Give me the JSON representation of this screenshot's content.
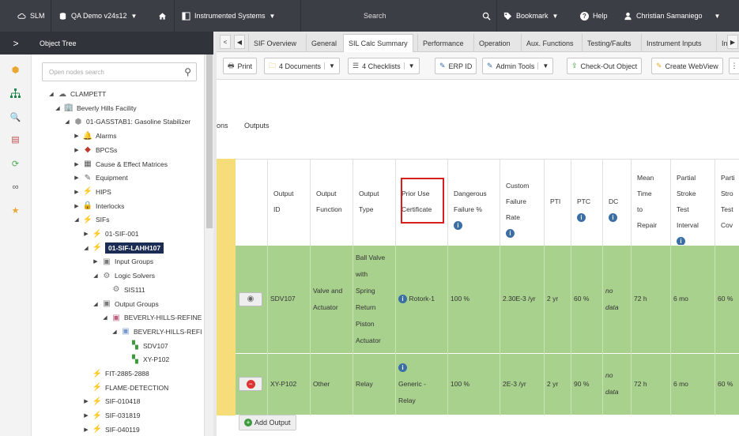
{
  "topbar": {
    "app": "SLM",
    "database": "QA Demo v24s12",
    "object_type": "Instrumented Systems",
    "search_placeholder": "Search",
    "bookmark": "Bookmark",
    "help": "Help",
    "user": "Christian Samaniego"
  },
  "left": {
    "title": "Object Tree",
    "search_placeholder": "Open nodes search",
    "tree": [
      {
        "label": "CLAMPETT",
        "expander": "◢"
      },
      {
        "label": "Beverly Hills Facility",
        "expander": "◢"
      },
      {
        "label": "01-GASSTAB1: Gasoline Stabilizer",
        "expander": "◢"
      },
      {
        "label": "Alarms",
        "expander": "▶"
      },
      {
        "label": "BPCSs",
        "expander": "▶"
      },
      {
        "label": "Cause & Effect Matrices",
        "expander": "▶"
      },
      {
        "label": "Equipment",
        "expander": "▶"
      },
      {
        "label": "HIPS",
        "expander": "▶"
      },
      {
        "label": "Interlocks",
        "expander": "▶"
      },
      {
        "label": "SIFs",
        "expander": "◢"
      },
      {
        "label": "01-SIF-001",
        "expander": "▶"
      },
      {
        "label": "01-SIF-LAHH107",
        "expander": "◢"
      },
      {
        "label": "Input Groups",
        "expander": "▶"
      },
      {
        "label": "Logic Solvers",
        "expander": "◢"
      },
      {
        "label": "SIS111",
        "expander": ""
      },
      {
        "label": "Output Groups",
        "expander": "◢"
      },
      {
        "label": "BEVERLY-HILLS-REFINE",
        "expander": "◢"
      },
      {
        "label": "BEVERLY-HILLS-REFI",
        "expander": "◢"
      },
      {
        "label": "SDV107",
        "expander": ""
      },
      {
        "label": "XY-P102",
        "expander": ""
      },
      {
        "label": "FIT-2885-2888",
        "expander": ""
      },
      {
        "label": "FLAME-DETECTION",
        "expander": ""
      },
      {
        "label": "SIF-010418",
        "expander": "▶"
      },
      {
        "label": "SIF-031819",
        "expander": "▶"
      },
      {
        "label": "SIF-040119",
        "expander": "▶"
      }
    ]
  },
  "tabs": [
    "SIF Overview",
    "General",
    "SIL Calc Summary",
    "Performance",
    "Operation",
    "Aux. Functions",
    "Testing/Faults",
    "Instrument Inputs",
    "In"
  ],
  "active_tab": "SIL Calc Summary",
  "toolbar": {
    "print": "Print",
    "documents": "4 Documents",
    "checklists": "4 Checklists",
    "erp": "ERP ID",
    "admin": "Admin Tools",
    "checkout": "Check-Out Object",
    "webview": "Create WebView"
  },
  "section": {
    "cut_label": "ons",
    "outputs_label": "Outputs"
  },
  "table": {
    "headers": {
      "output_id": [
        "Output",
        "ID"
      ],
      "output_function": [
        "Output",
        "Function"
      ],
      "output_type": [
        "Output",
        "Type"
      ],
      "prior_use": [
        "Prior Use",
        "Certificate"
      ],
      "dangerous": [
        "Dangerous",
        "Failure %"
      ],
      "custom": [
        "Custom",
        "Failure",
        "Rate"
      ],
      "pti": [
        "PTI"
      ],
      "ptc": [
        "PTC"
      ],
      "dc": [
        "DC"
      ],
      "mttr": [
        "Mean",
        "Time",
        "to",
        "Repair"
      ],
      "partial_stroke": [
        "Partial",
        "Stroke",
        "Test",
        "Interval"
      ],
      "partial_cov": [
        "Parti",
        "Stro",
        "Test",
        "Cov"
      ]
    },
    "rows": [
      {
        "id": "SDV107",
        "function": [
          "Valve and",
          "Actuator"
        ],
        "type": [
          "Ball Valve",
          "with",
          "Spring",
          "Return",
          "Piston",
          "Actuator"
        ],
        "prior_use": "Rotork-1",
        "dangerous": "100 %",
        "custom": "2.30E-3 /yr",
        "pti": "2 yr",
        "ptc": "60 %",
        "dc": [
          "no",
          "data"
        ],
        "mttr": "72 h",
        "pst": "6 mo",
        "cov": "60 %"
      },
      {
        "id": "XY-P102",
        "function": [
          "Other"
        ],
        "type": [
          "Relay"
        ],
        "prior_use": [
          "Generic -",
          "Relay"
        ],
        "dangerous": "100 %",
        "custom": "2E-3 /yr",
        "pti": "2 yr",
        "ptc": "90 %",
        "dc": [
          "no",
          "data"
        ],
        "mttr": "72 h",
        "pst": "6 mo",
        "cov": "60 %"
      }
    ],
    "add_output": "Add Output"
  },
  "colors": {
    "topbar": "#3b3f45",
    "row_green": "#a9d18e",
    "yellow": "#f7dd7a",
    "highlight": "#d62020",
    "selected": "#1b2c55"
  }
}
